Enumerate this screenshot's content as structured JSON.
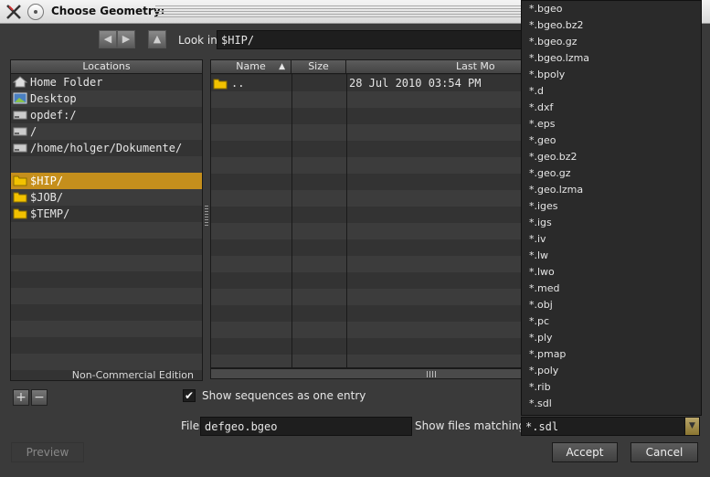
{
  "window": {
    "title": "Choose Geometry:"
  },
  "toolbar": {
    "look_in_label": "Look in",
    "look_in_value": "$HIP/"
  },
  "locations": {
    "header": "Locations",
    "items": [
      {
        "label": "Home Folder",
        "icon": "home-icon"
      },
      {
        "label": "Desktop",
        "icon": "desktop-icon"
      },
      {
        "label": "opdef:/",
        "icon": "drive-icon"
      },
      {
        "label": "/",
        "icon": "drive-icon"
      },
      {
        "label": "/home/holger/Dokumente/",
        "icon": "drive-icon"
      },
      {
        "label": "",
        "icon": ""
      },
      {
        "label": "$HIP/",
        "icon": "folder-icon",
        "selected": true
      },
      {
        "label": "$JOB/",
        "icon": "folder-icon"
      },
      {
        "label": "$TEMP/",
        "icon": "folder-icon"
      }
    ],
    "footer_note": "Non-Commercial Edition"
  },
  "file_list": {
    "columns": {
      "name": "Name",
      "sort_indicator": "▲",
      "size": "Size",
      "modified": "Last Mo"
    },
    "rows": [
      {
        "name": "..",
        "size": "",
        "modified": "28 Jul 2010 03:54 PM"
      }
    ]
  },
  "options": {
    "sequences_label": "Show sequences as one entry",
    "sequences_checked": true
  },
  "file_field": {
    "label": "File",
    "value": "defgeo.bgeo"
  },
  "filter": {
    "label": "Show files matching",
    "value": "*.sdl",
    "options": [
      "*.bgeo",
      "*.bgeo.bz2",
      "*.bgeo.gz",
      "*.bgeo.lzma",
      "*.bpoly",
      "*.d",
      "*.dxf",
      "*.eps",
      "*.geo",
      "*.geo.bz2",
      "*.geo.gz",
      "*.geo.lzma",
      "*.iges",
      "*.igs",
      "*.iv",
      "*.lw",
      "*.lwo",
      "*.med",
      "*.obj",
      "*.pc",
      "*.ply",
      "*.pmap",
      "*.poly",
      "*.rib",
      "*.sdl"
    ]
  },
  "buttons": {
    "add": "+",
    "remove": "−",
    "preview": "Preview",
    "accept": "Accept",
    "cancel": "Cancel"
  },
  "colors": {
    "selection": "#c58f1c",
    "folder": "#f2c200"
  }
}
